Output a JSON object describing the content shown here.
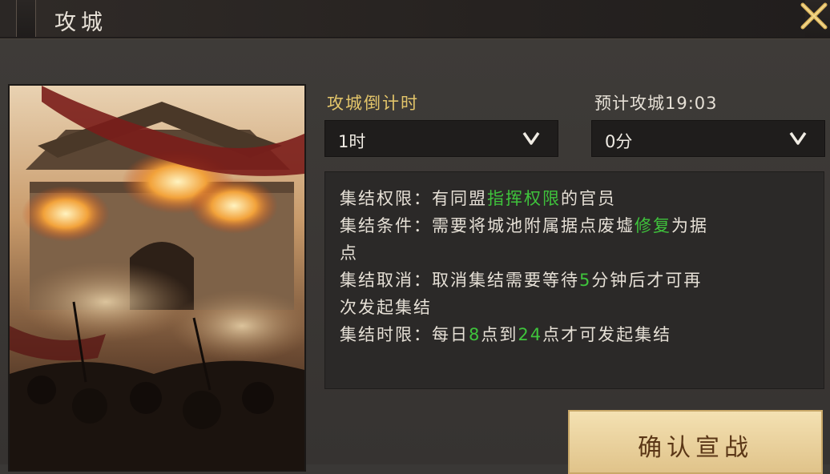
{
  "header": {
    "title": "攻城",
    "close_icon": "close-x-icon"
  },
  "illustration": {
    "subject": "burning city gate battle scene"
  },
  "countdown": {
    "label": "攻城倒计时",
    "hour_value": "1时",
    "minute_value": "0分"
  },
  "estimate": {
    "label": "预计攻城19:03"
  },
  "info": {
    "line1": {
      "a": "集结权限：有同盟",
      "b": "指挥权限",
      "c": "的官员"
    },
    "line2": {
      "a": "集结条件：需要将城池附属据点废墟",
      "b": "修复",
      "c": "为据"
    },
    "line3": {
      "a": "点"
    },
    "line4": {
      "a": "集结取消：取消集结需要等待",
      "b": "5",
      "c": "分钟后才可再"
    },
    "line5": {
      "a": "次发起集结"
    },
    "line6": {
      "a": "集结时限：每日",
      "b": "8",
      "c": "点到",
      "d": "24",
      "e": "点才可发起集结"
    }
  },
  "confirm": {
    "label": "确认宣战"
  },
  "colors": {
    "accent_gold": "#e3c56a",
    "highlight_green": "#3fc43c",
    "button_bg": "#f0dcaa"
  }
}
